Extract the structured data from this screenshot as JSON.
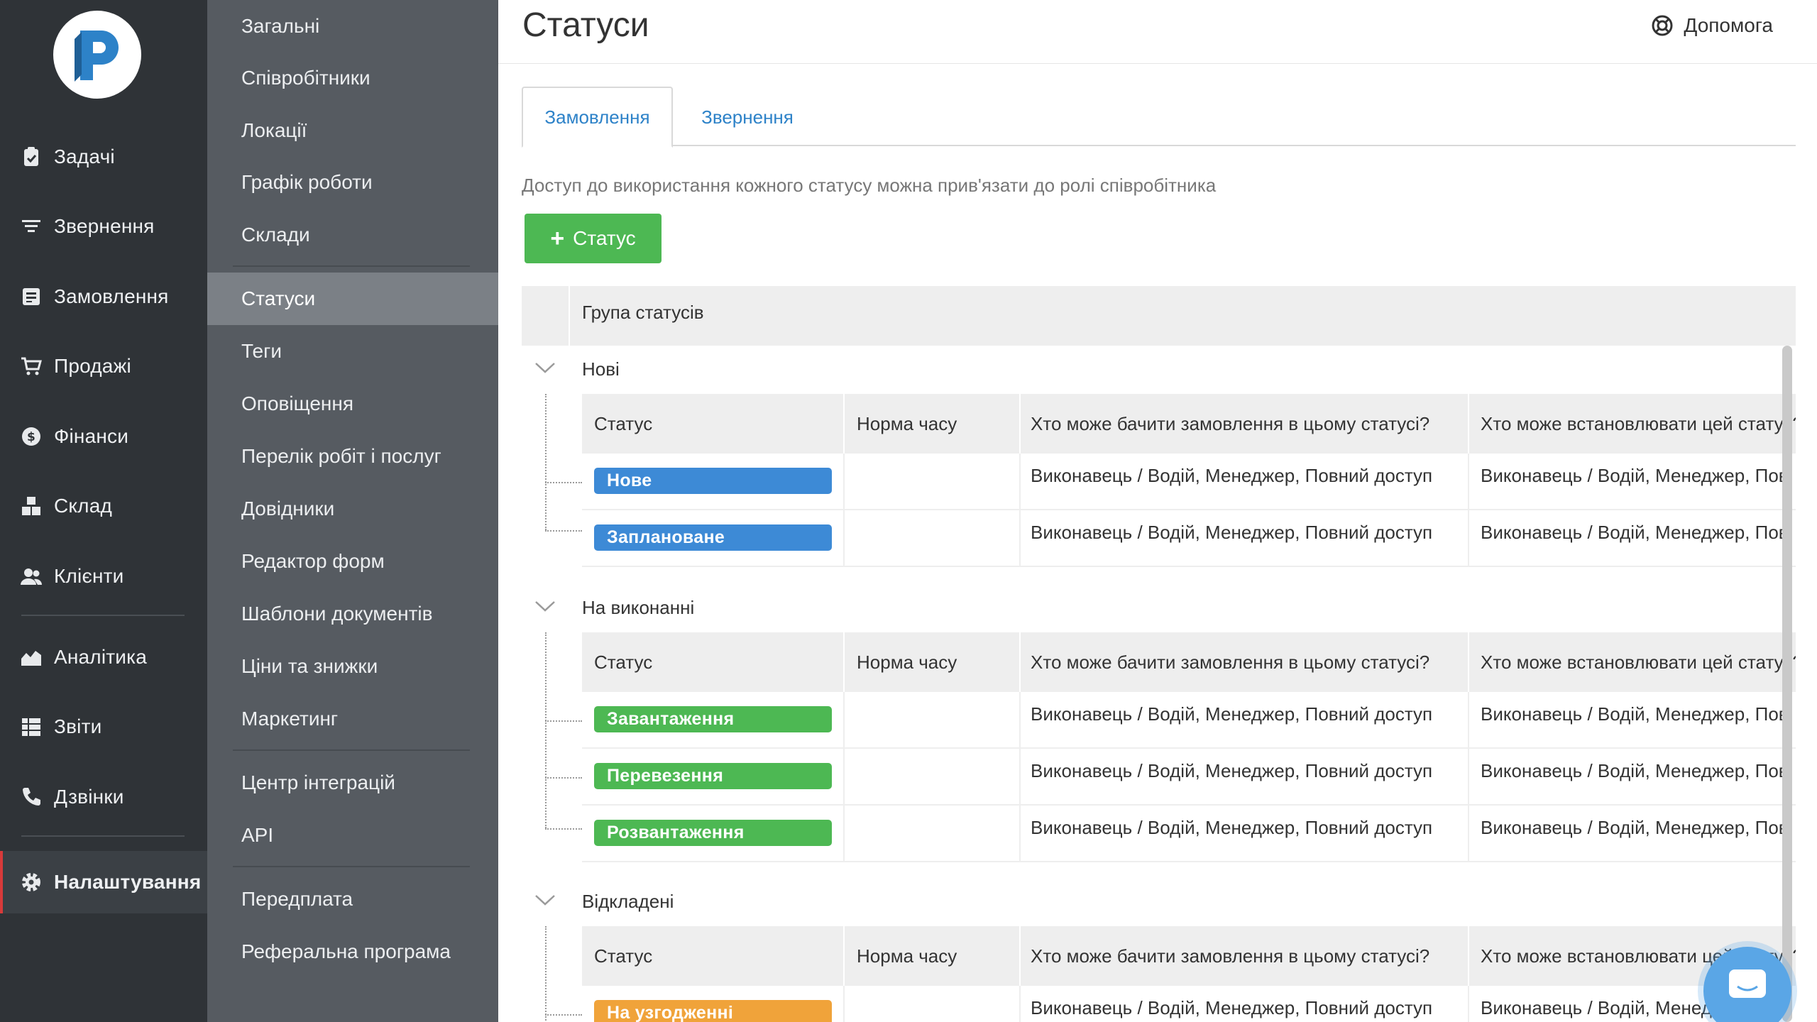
{
  "nav": {
    "items": [
      {
        "label": "Задачі",
        "icon": "clipboard-check-icon"
      },
      {
        "label": "Звернення",
        "icon": "filter-icon"
      },
      {
        "label": "Замовлення",
        "icon": "order-list-icon"
      },
      {
        "label": "Продажі",
        "icon": "cart-icon"
      },
      {
        "label": "Фінанси",
        "icon": "dollar-coin-icon"
      },
      {
        "label": "Склад",
        "icon": "boxes-icon"
      },
      {
        "label": "Клієнти",
        "icon": "users-icon"
      },
      {
        "label": "Аналітика",
        "icon": "area-chart-icon"
      },
      {
        "label": "Звіти",
        "icon": "report-list-icon"
      },
      {
        "label": "Дзвінки",
        "icon": "phone-icon"
      },
      {
        "label": "Налаштування",
        "icon": "gear-icon"
      }
    ],
    "active_color": "#d83a3a"
  },
  "submenu": {
    "items": [
      "Загальні",
      "Співробітники",
      "Локації",
      "Графік роботи",
      "Склади",
      "Статуси",
      "Теги",
      "Оповіщення",
      "Перелік робіт і послуг",
      "Довідники",
      "Редактор форм",
      "Шаблони документів",
      "Ціни та знижки",
      "Маркетинг",
      "Центр інтеграцій",
      "API",
      "Передплата",
      "Реферальна програма"
    ],
    "active": "Статуси"
  },
  "header": {
    "title": "Статуси",
    "help_label": "Допомога"
  },
  "tabs": [
    "Замовлення",
    "Звернення"
  ],
  "hint": "Доступ до використання кожного статусу можна прив'язати до ролі співробітника",
  "add_button_label": "Статус",
  "table": {
    "group_header": "Група статусів",
    "columns": [
      "Статус",
      "Норма часу",
      "Хто може бачити замовлення в цьому статусі?",
      "Хто може встановлювати цей статус?"
    ],
    "groups": [
      {
        "name": "Нові",
        "rows": [
          {
            "status": "Нове",
            "color": "#3d8ad6",
            "time": "",
            "view": "Виконавець / Водій,  Менеджер,  Повний доступ",
            "set": "Виконавець / Водій,  Менеджер,  Пов"
          },
          {
            "status": "Заплановане",
            "color": "#3d8ad6",
            "time": "",
            "view": "Виконавець / Водій,  Менеджер,  Повний доступ",
            "set": "Виконавець / Водій,  Менеджер,  Пов"
          }
        ]
      },
      {
        "name": "На виконанні",
        "rows": [
          {
            "status": "Завантаження",
            "color": "#4db853",
            "time": "",
            "view": "Виконавець / Водій,  Менеджер,  Повний доступ",
            "set": "Виконавець / Водій,  Менеджер,  Пов"
          },
          {
            "status": "Перевезення",
            "color": "#4db853",
            "time": "",
            "view": "Виконавець / Водій,  Менеджер,  Повний доступ",
            "set": "Виконавець / Водій,  Менеджер,  Пов"
          },
          {
            "status": "Розвантаження",
            "color": "#4db853",
            "time": "",
            "view": "Виконавець / Водій,  Менеджер,  Повний доступ",
            "set": "Виконавець / Водій,  Менеджер,  Пов"
          }
        ]
      },
      {
        "name": "Відкладені",
        "rows": [
          {
            "status": "На узгодженні",
            "color": "#f0a33a",
            "time": "",
            "view": "Виконавець / Водій,  Менеджер,  Повний доступ",
            "set": "Виконавець / Водій,  Менеджер,  Пов"
          }
        ]
      }
    ]
  },
  "colors": {
    "accent_blue": "#2d82c8",
    "button_green": "#4db853"
  }
}
